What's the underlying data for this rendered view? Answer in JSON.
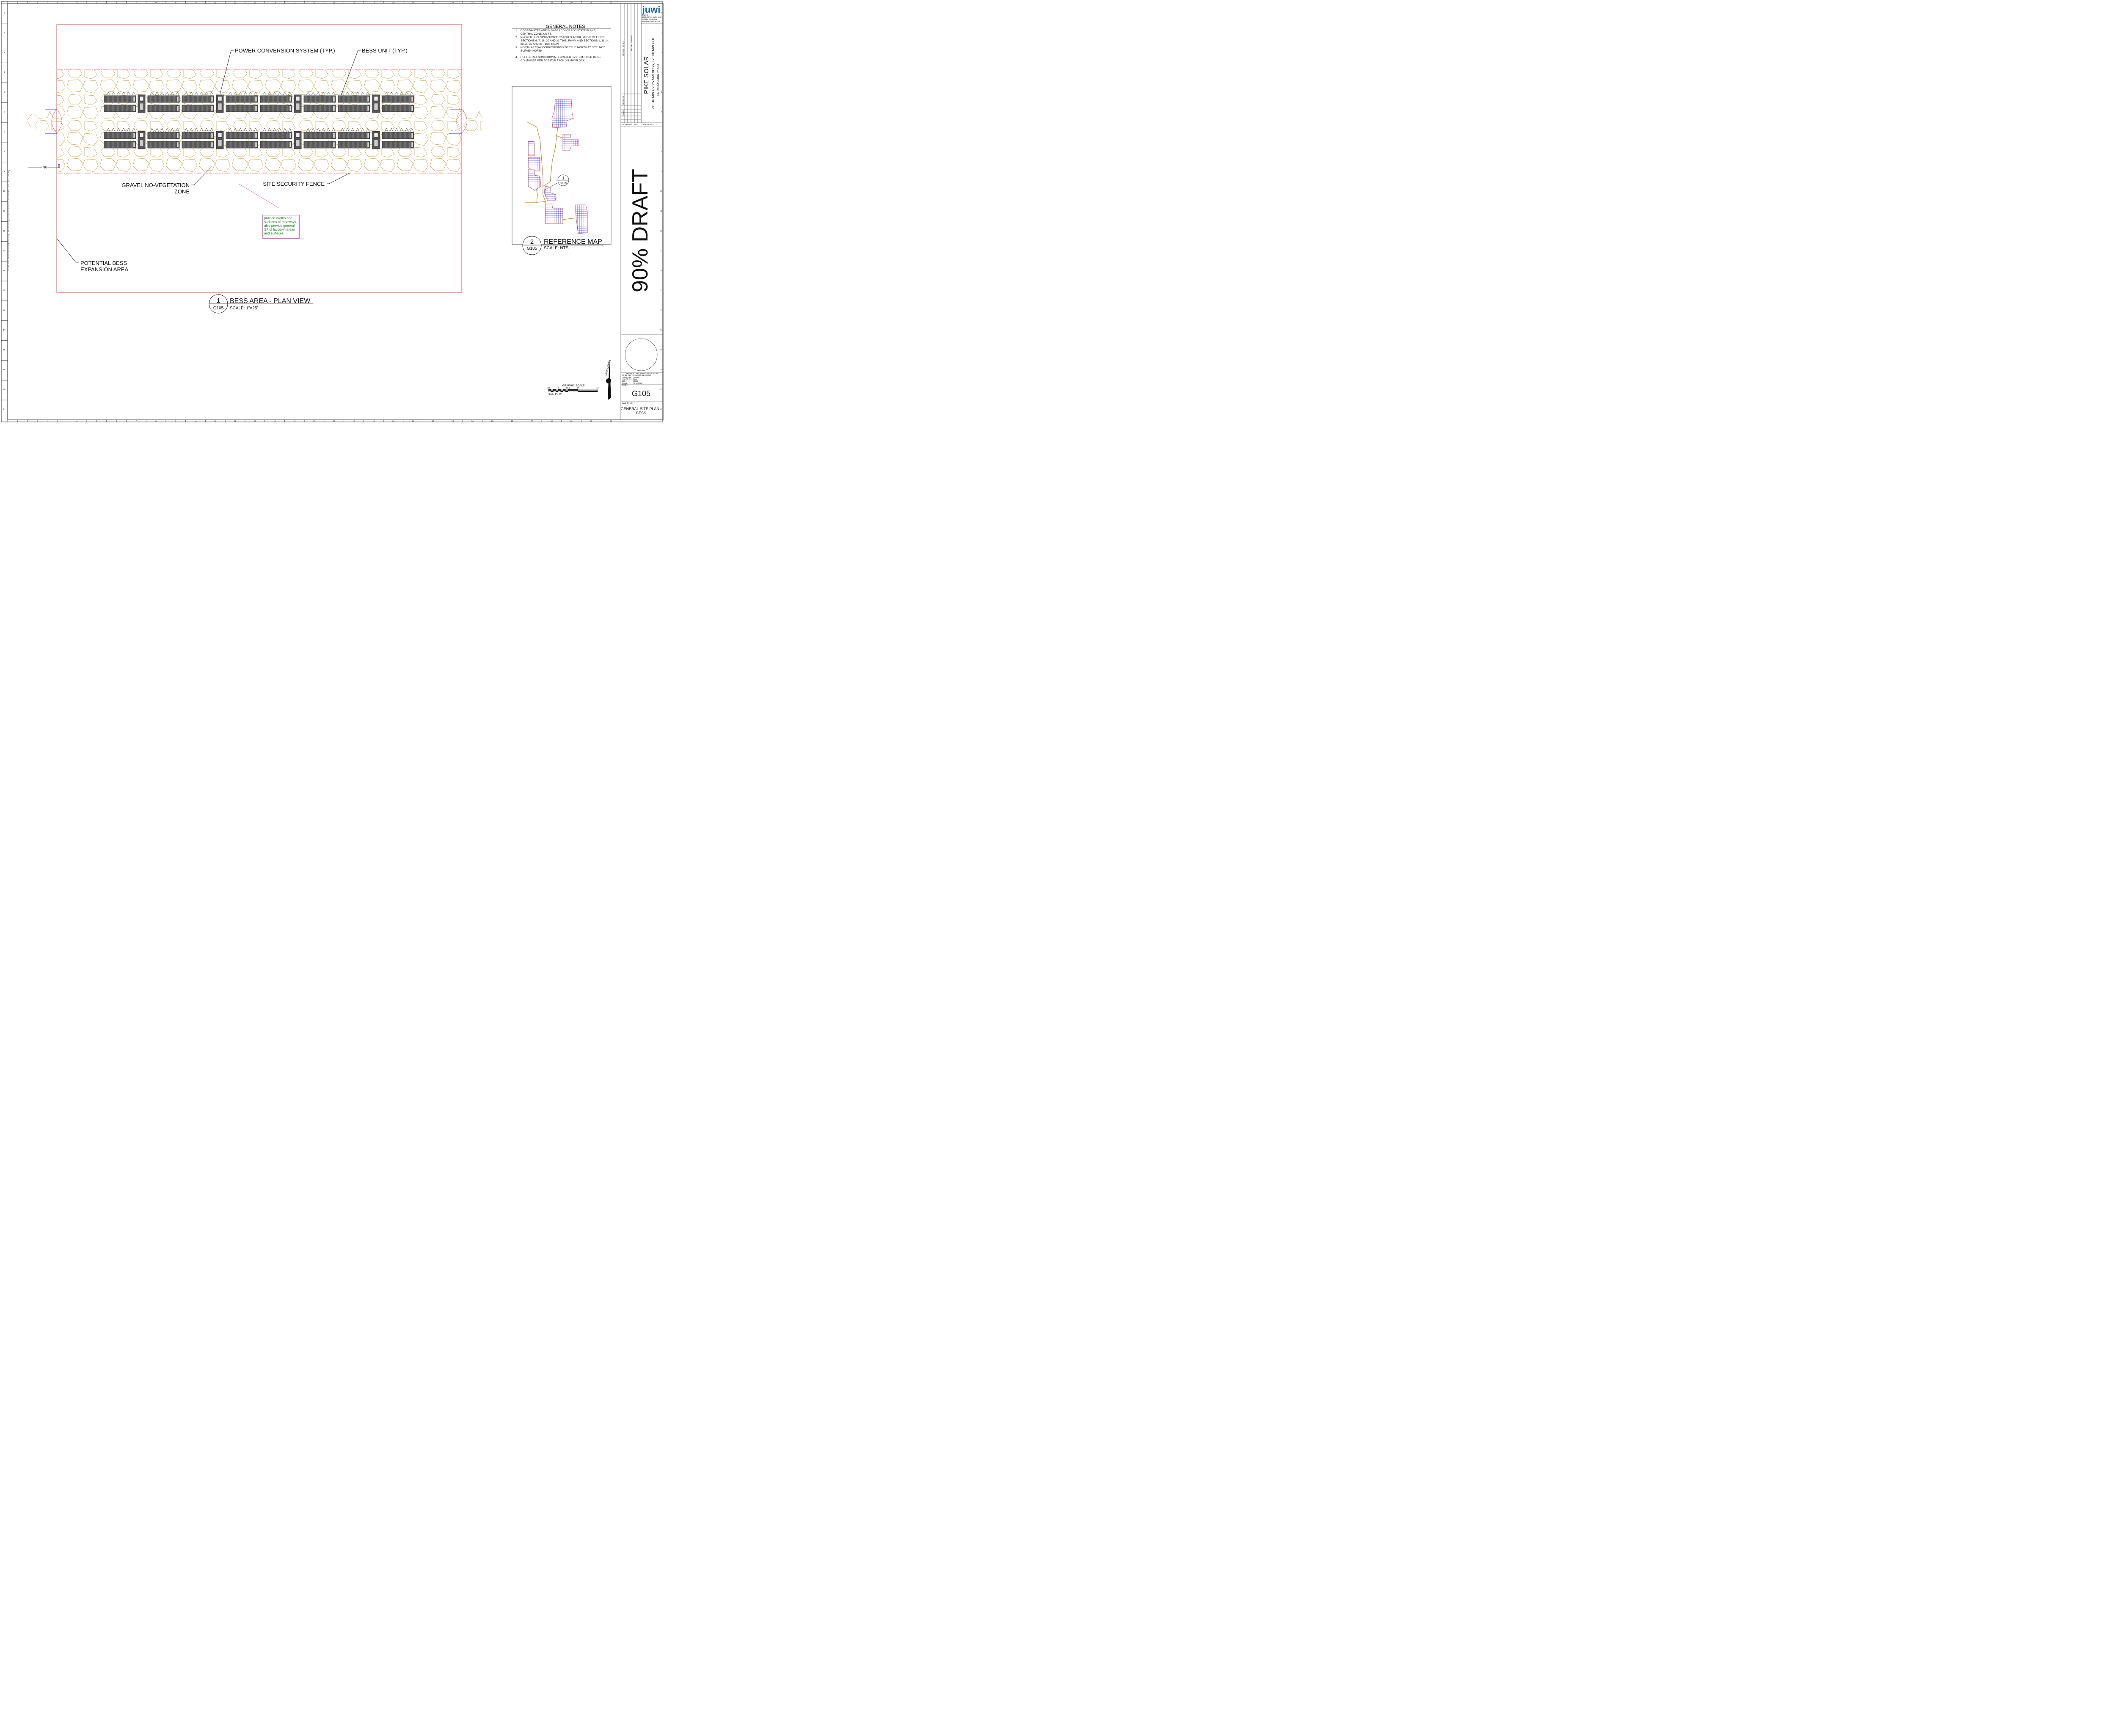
{
  "drawing": {
    "title": "BESS AREA - PLAN VIEW",
    "detail_number": "1",
    "detail_sheet": "G105",
    "scale": "SCALE:  1\"=25'",
    "callouts": {
      "pcs": "POWER CONVERSION SYSTEM (TYP.)",
      "bess_unit": "BESS UNIT (TYP.)",
      "gravel_line1": "GRAVEL NO-VEGETATION",
      "gravel_line2": "ZONE",
      "fence": "SITE SECURITY FENCE",
      "expansion_line1": "POTENTIAL BESS",
      "expansion_line2": "EXPANSION AREA",
      "section_tag": "9U"
    },
    "comment_box": "provide widths and surfaces of roadways, also provide general SF of laydown areas and surfaces",
    "left_path_text": "T:\\C0465 - CSU - Pike Solar\\ENGINEERING\\3 Drawings\\1 AutoCAD Working Drawings\\G Generals\\G105 - General Site Plan - BESS Layout - Cristy Berg"
  },
  "general_notes": {
    "heading": "GENERAL NOTES",
    "items": [
      {
        "num": "1",
        "lines": [
          "COORDINATES ARE IN NAD83 COLORADO STATE PLANE,",
          "CENTRAL ZONE, US FT."
        ]
      },
      {
        "num": "2",
        "lines": [
          "PROPERTY DESCRIPTION:1162 ACRES INSIDE PROJECT FENCE,",
          "SECTIONS 6, 7, 18, 30 AND 31 T16S, R64W, AND SECTIONS 1, 11-14,",
          "23-26, 35 AND 36 T16S, R65W"
        ]
      },
      {
        "num": "3",
        "lines": [
          "NORTH ARROW CORRESPONDS TO TRUE NORTH AT SITE, NOT",
          "SURVEY NORTH"
        ]
      },
      {
        "num": "4",
        "lines": [
          "REFLECTS A SUNGROW INTEGRATED SYSTEM. FOUR BESS",
          "CONTAINER PER PCS FOR EACH 3.5 MW BLOCK."
        ]
      }
    ]
  },
  "reference_map": {
    "title": "REFERENCE MAP",
    "detail_number": "2",
    "detail_sheet": "G105",
    "scale": "SCALE:  NTS",
    "marker_number": "1",
    "marker_sheet": "G105"
  },
  "graphic_scale": {
    "title": "GRAPHIC SCALE",
    "ticks": [
      "13.5",
      "0",
      "13.5",
      "27",
      "54"
    ],
    "caption": "Scale: 1\"= 27'",
    "north_label": "TRUE NORTH"
  },
  "watermark": "90% DRAFT",
  "title_block": {
    "logo": "juwi",
    "company_lines": [
      "juwi Inc.",
      "1710 29th St. Suite 1068",
      "Boulder, CO 80301",
      "www.juwiamericas.com"
    ],
    "project_title": "PIKE SOLAR",
    "project_subtitle": "219.46 MW PV, 25 MW BESS, 175.00 MW POI",
    "project_location": "EL PASO COUNTY, CO",
    "revision_notes_label": "REVISION NOTES",
    "rev_note": "REF SET UPDATED",
    "reviewed_label": "REVIEWED",
    "drawn_label": "DRAWN",
    "drawn_by_label": "DRAWN BY:",
    "drawn_by": "PDT",
    "latest_rev_label": "LATEST REV:",
    "latest_rev": "C",
    "confidential": "PROPRIETARY AND CONFIDENTIAL",
    "color_note": "TO BE REPRODUCED IN COLOR",
    "meta": [
      {
        "k": "PRINT SIZE:",
        "v": "ARCH D"
      },
      {
        "k": "ISSUED BY:",
        "v": "JUWI"
      },
      {
        "k": "JOB #:",
        "v": "C0465"
      },
      {
        "k": "SCALE:",
        "v": "AS SHOWN"
      },
      {
        "k": "DWG #:",
        "v": ""
      }
    ],
    "dwg_number": "G105",
    "dwg_title_label": "DWG TITLE:",
    "dwg_title_line1": "GENERAL SITE PLAN -",
    "dwg_title_line2": "BESS"
  },
  "grid": {
    "columns": [
      "1",
      "2",
      "3",
      "4",
      "5",
      "6",
      "7",
      "8",
      "9",
      "10",
      "11",
      "12",
      "13",
      "14",
      "15",
      "16",
      "17",
      "18",
      "19",
      "20",
      "21",
      "22",
      "23",
      "24",
      "25",
      "26",
      "27",
      "28",
      "29",
      "30",
      "31"
    ],
    "rows": [
      "1",
      "2",
      "3",
      "4",
      "5",
      "6",
      "7",
      "8",
      "9",
      "10",
      "11",
      "12",
      "13",
      "14",
      "15",
      "16",
      "17",
      "18",
      "19",
      "20",
      "21"
    ]
  },
  "colors": {
    "boundary": "#e05050",
    "gravel": "#c8a040",
    "array_blue": "#3030e0",
    "road": "#c88a1e",
    "container": "#555555",
    "comment_text": "#2a7a2a"
  }
}
